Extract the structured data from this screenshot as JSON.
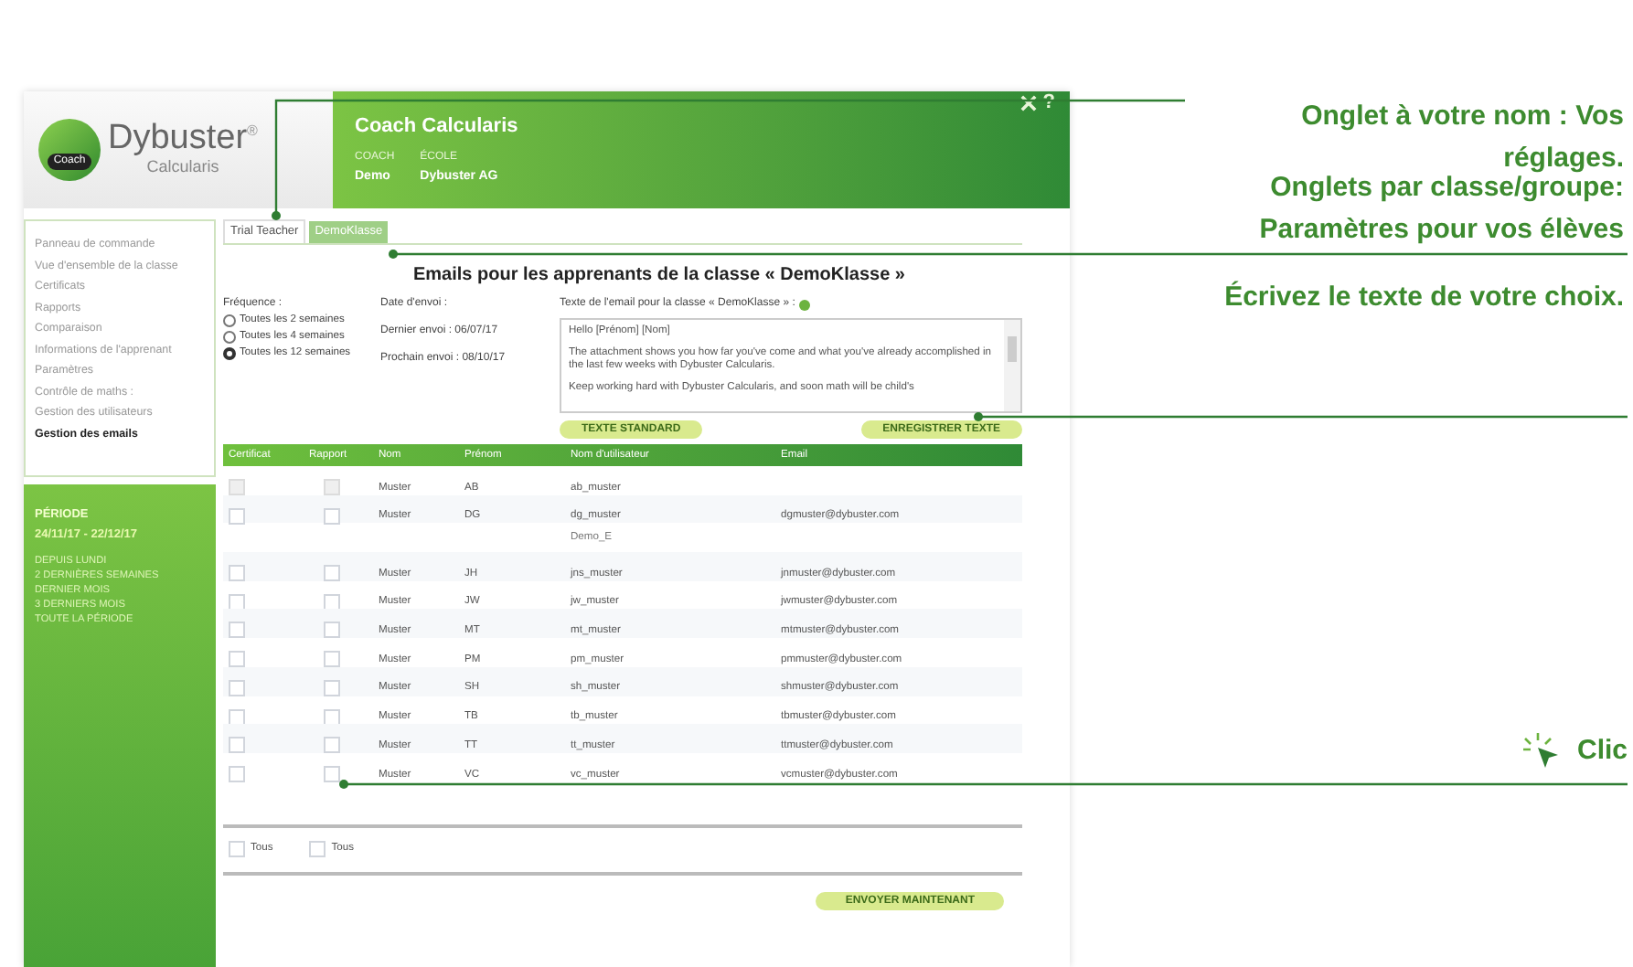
{
  "logo": {
    "badge": "Coach",
    "brand": "Dybuster",
    "mark": "®",
    "product": "Calcularis"
  },
  "header": {
    "title": "Coach Calcularis",
    "fields": [
      {
        "label": "COACH",
        "value": "Demo"
      },
      {
        "label": "ÉCOLE",
        "value": "Dybuster AG"
      }
    ],
    "help": "?"
  },
  "sidebar": {
    "items": [
      {
        "label": "Panneau de commande",
        "selected": false
      },
      {
        "label": "Vue d'ensemble de la classe",
        "selected": false
      },
      {
        "label": "Certificats",
        "selected": false
      },
      {
        "label": "Rapports",
        "selected": false
      },
      {
        "label": "Comparaison",
        "selected": false
      },
      {
        "label": "Informations de l'apprenant",
        "selected": false
      },
      {
        "label": "Paramètres",
        "selected": false
      },
      {
        "label": "Contrôle de maths :",
        "selected": false
      },
      {
        "label": "Gestion des utilisateurs",
        "selected": false
      },
      {
        "label": "Gestion des emails",
        "selected": true
      }
    ]
  },
  "period": {
    "title": "PÉRIODE",
    "range": "24/11/17 - 22/12/17",
    "options": [
      "DEPUIS LUNDI",
      "2 DERNIÈRES SEMAINES",
      "DERNIER MOIS",
      "3 DERNIERS MOIS",
      "TOUTE LA PÉRIODE"
    ]
  },
  "tabs": [
    {
      "label": "Trial Teacher",
      "selected": false
    },
    {
      "label": "DemoKlasse",
      "selected": true
    }
  ],
  "title": "Emails pour les apprenants de la classe « DemoKlasse »",
  "frequency": {
    "label": "Fréquence :",
    "options": [
      {
        "label": "Toutes les 2 semaines",
        "selected": false
      },
      {
        "label": "Toutes les 4 semaines",
        "selected": false
      },
      {
        "label": "Toutes les 12 semaines",
        "selected": true
      }
    ]
  },
  "send_date": {
    "label": "Date d'envoi :",
    "last": "Dernier envoi : 06/07/17",
    "next": "Prochain envoi : 08/10/17"
  },
  "email_text": {
    "label": "Texte de l'email pour la classe « DemoKlasse » :",
    "paragraphs": [
      "Hello [Prénom] [Nom]",
      "The attachment shows you how far you've come and what you've already accomplished in the last few weeks with Dybuster Calcularis.",
      "Keep working hard with Dybuster Calcularis, and soon math will be child's"
    ]
  },
  "text_buttons": [
    "TEXTE STANDARD",
    "ENREGISTRER TEXTE"
  ],
  "table": {
    "columns": [
      "Certificat",
      "Rapport",
      "Nom",
      "Prénom",
      "Nom d'utilisateur",
      "Email"
    ],
    "rows": [
      {
        "kind": "user",
        "disabled": true,
        "certificate": false,
        "report": false,
        "last": "Muster",
        "first": "AB",
        "username": "ab_muster"
      },
      {
        "kind": "user",
        "disabled": false,
        "certificate": false,
        "report": false,
        "last": "Muster",
        "first": "DG",
        "username": "dg_muster",
        "email": "dgmuster@dybuster.com"
      },
      {
        "kind": "group",
        "username": "Demo_E"
      },
      {
        "kind": "user",
        "disabled": false,
        "certificate": false,
        "report": false,
        "last": "Muster",
        "first": "JH",
        "username": "jns_muster",
        "email": "jnmuster@dybuster.com"
      },
      {
        "kind": "user",
        "disabled": false,
        "certificate": false,
        "report": false,
        "last": "Muster",
        "first": "JW",
        "username": "jw_muster",
        "email": "jwmuster@dybuster.com"
      },
      {
        "kind": "user",
        "disabled": false,
        "certificate": false,
        "report": false,
        "last": "Muster",
        "first": "MT",
        "username": "mt_muster",
        "email": "mtmuster@dybuster.com"
      },
      {
        "kind": "user",
        "disabled": false,
        "certificate": false,
        "report": false,
        "last": "Muster",
        "first": "PM",
        "username": "pm_muster",
        "email": "pmmuster@dybuster.com"
      },
      {
        "kind": "user",
        "disabled": false,
        "certificate": false,
        "report": false,
        "last": "Muster",
        "first": "SH",
        "username": "sh_muster",
        "email": "shmuster@dybuster.com"
      },
      {
        "kind": "user",
        "disabled": false,
        "certificate": false,
        "report": false,
        "last": "Muster",
        "first": "TB",
        "username": "tb_muster",
        "email": "tbmuster@dybuster.com"
      },
      {
        "kind": "user",
        "disabled": false,
        "certificate": false,
        "report": false,
        "last": "Muster",
        "first": "TT",
        "username": "tt_muster",
        "email": "ttmuster@dybuster.com"
      },
      {
        "kind": "user",
        "disabled": false,
        "certificate": false,
        "report": false,
        "last": "Muster",
        "first": "VC",
        "username": "vc_muster",
        "email": "vcmuster@dybuster.com"
      }
    ]
  },
  "select_all": [
    {
      "label": "Tous",
      "checked": false
    },
    {
      "label": "Tous",
      "checked": false
    }
  ],
  "send_button": "ENVOYER MAINTENANT",
  "annotations": [
    {
      "kind": "note",
      "text": "Onglet à votre nom : Vos réglages."
    },
    {
      "kind": "note",
      "text": "Onglets par classe/groupe: Paramètres pour vos élèves"
    },
    {
      "kind": "note",
      "text": "Écrivez le texte de votre choix."
    },
    {
      "kind": "click",
      "text": "Clic"
    }
  ]
}
